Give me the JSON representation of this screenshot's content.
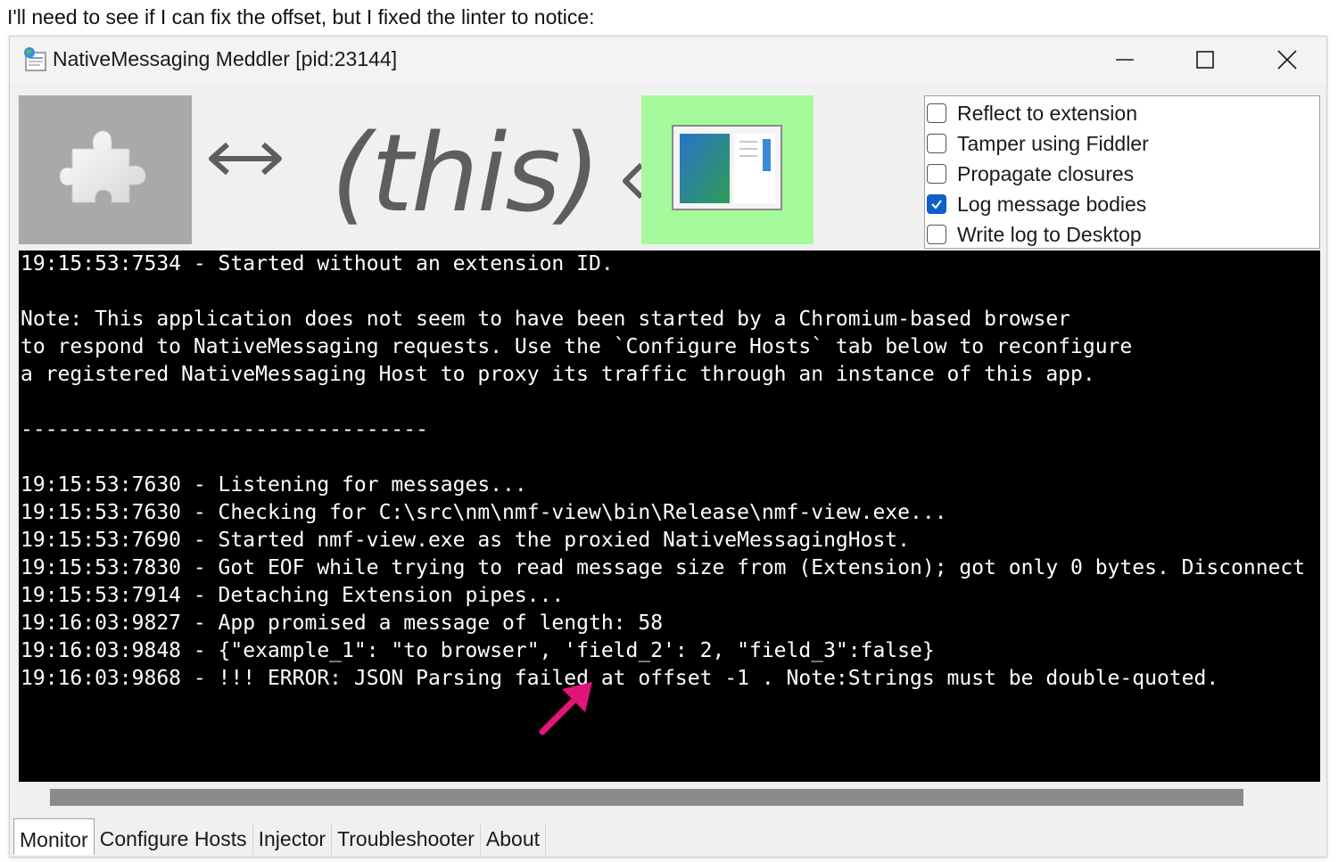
{
  "caption": "I'll need to see if I can fix the offset, but I fixed the linter to notice:",
  "window": {
    "title": "NativeMessaging Meddler [pid:23144]",
    "controls": {
      "minimize_icon": "minimize-icon",
      "maximize_icon": "maximize-icon",
      "close_icon": "close-icon"
    }
  },
  "header": {
    "this_text": "(this)",
    "options": [
      {
        "label": "Reflect to extension",
        "checked": false
      },
      {
        "label": "Tamper using Fiddler",
        "checked": false
      },
      {
        "label": "Propagate closures",
        "checked": false
      },
      {
        "label": "Log message bodies",
        "checked": true
      },
      {
        "label": "Write log to Desktop",
        "checked": false
      }
    ]
  },
  "console": {
    "lines": [
      "19:15:53:7534 - Started without an extension ID.",
      "",
      "Note: This application does not seem to have been started by a Chromium-based browser",
      "to respond to NativeMessaging requests. Use the `Configure Hosts` tab below to reconfigure",
      "a registered NativeMessaging Host to proxy its traffic through an instance of this app.",
      "",
      "---------------------------------",
      "",
      "19:15:53:7630 - Listening for messages...",
      "19:15:53:7630 - Checking for C:\\src\\nm\\nmf-view\\bin\\Release\\nmf-view.exe...",
      "19:15:53:7690 - Started nmf-view.exe as the proxied NativeMessagingHost.",
      "19:15:53:7830 - Got EOF while trying to read message size from (Extension); got only 0 bytes. Disconnect",
      "19:15:53:7914 - Detaching Extension pipes...",
      "19:16:03:9827 - App promised a message of length: 58",
      "19:16:03:9848 - {\"example_1\": \"to browser\", 'field_2': 2, \"field_3\":false}",
      "19:16:03:9868 - !!! ERROR: JSON Parsing failed at offset -1 . Note:Strings must be double-quoted."
    ]
  },
  "tabs": [
    "Monitor",
    "Configure Hosts",
    "Injector",
    "Troubleshooter",
    "About"
  ],
  "active_tab": "Monitor",
  "colors": {
    "console_bg": "#000000",
    "console_fg": "#ffffff",
    "annotation_arrow": "#e0157a",
    "checkbox_checked": "#1060c8",
    "browser_box": "#a5fb9c",
    "extension_box": "#a9a9a9"
  }
}
